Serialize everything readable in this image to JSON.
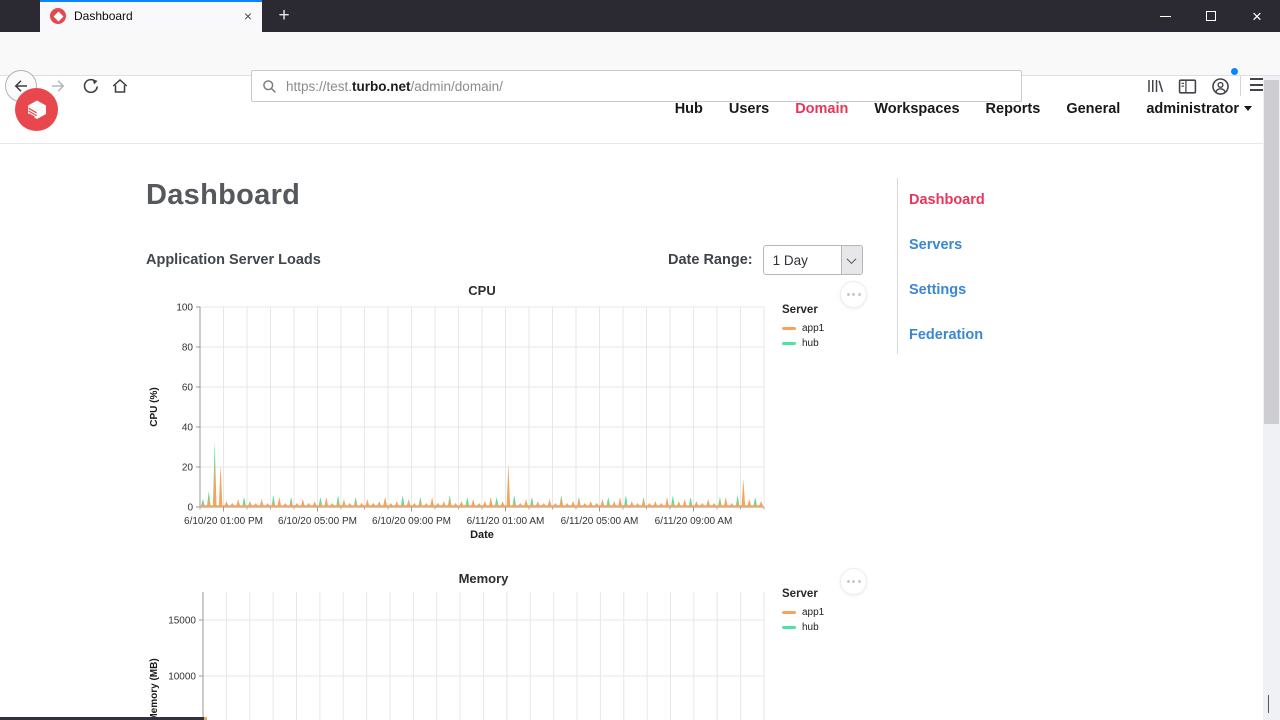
{
  "browser": {
    "tab_title": "Dashboard",
    "new_tab_glyph": "+",
    "tab_close_glyph": "×",
    "window_close_glyph": "×",
    "url_scheme": "https://test.",
    "url_domain": "turbo.net",
    "url_path": "/admin/domain/"
  },
  "header": {
    "nav": [
      {
        "label": "Hub"
      },
      {
        "label": "Users"
      },
      {
        "label": "Domain",
        "active": true
      },
      {
        "label": "Workspaces"
      },
      {
        "label": "Reports"
      },
      {
        "label": "General"
      }
    ],
    "user_label": "administrator"
  },
  "page": {
    "title": "Dashboard",
    "section_title": "Application Server Loads",
    "date_range_label": "Date Range:",
    "date_range_value": "1 Day"
  },
  "sidebar": {
    "items": [
      {
        "label": "Dashboard",
        "active": true
      },
      {
        "label": "Servers",
        "active": false
      },
      {
        "label": "Settings",
        "active": false
      },
      {
        "label": "Federation",
        "active": false
      }
    ]
  },
  "colors": {
    "accent_red": "#e8355a",
    "link_blue": "#3a87d6",
    "logo_red": "#e8474e",
    "series_app1": "#f7a35c",
    "series_hub": "#4be3a2",
    "grid": "#e7e7e7",
    "axis": "#9a9a9a"
  },
  "chart_data": [
    {
      "type": "area",
      "title": "CPU",
      "ylabel": "CPU (%)",
      "xlabel": "Date",
      "ylim": [
        0,
        100
      ],
      "grid": true,
      "legend_position": "right",
      "legend_title": "Server",
      "y_ticks": [
        0,
        20,
        40,
        60,
        80,
        100
      ],
      "x_ticks": [
        "6/10/20 01:00 PM",
        "6/10/20 05:00 PM",
        "6/10/20 09:00 PM",
        "6/11/20 01:00 AM",
        "6/11/20 05:00 AM",
        "6/11/20 09:00 AM"
      ],
      "series": [
        {
          "name": "app1",
          "color": "#f7a35c",
          "values": [
            2,
            5,
            25,
            21,
            3,
            2,
            4,
            2,
            3,
            2,
            4,
            2,
            3,
            5,
            2,
            3,
            2,
            4,
            2,
            3,
            2,
            5,
            2,
            3,
            4,
            2,
            3,
            2,
            4,
            2,
            3,
            5,
            2,
            3,
            2,
            4,
            2,
            3,
            2,
            5,
            2,
            3,
            4,
            2,
            3,
            2,
            4,
            2,
            3,
            5,
            2,
            3,
            22,
            3,
            2,
            4,
            2,
            3,
            2,
            4,
            2,
            5,
            2,
            3,
            4,
            2,
            3,
            2,
            4,
            2,
            3,
            5,
            2,
            3,
            2,
            4,
            2,
            3,
            2,
            5,
            2,
            3,
            4,
            2,
            3,
            2,
            4,
            2,
            3,
            5,
            2,
            3,
            14,
            4,
            2,
            3
          ]
        },
        {
          "name": "hub",
          "color": "#4be3a2",
          "values": [
            4,
            8,
            33,
            5,
            2,
            1,
            1,
            5,
            1,
            1,
            2,
            1,
            6,
            1,
            1,
            5,
            1,
            1,
            2,
            1,
            5,
            1,
            1,
            6,
            1,
            1,
            5,
            1,
            1,
            2,
            1,
            5,
            1,
            1,
            6,
            1,
            1,
            5,
            1,
            1,
            2,
            1,
            6,
            1,
            1,
            5,
            1,
            1,
            2,
            1,
            5,
            1,
            1,
            6,
            1,
            1,
            5,
            1,
            1,
            2,
            1,
            6,
            1,
            1,
            5,
            1,
            1,
            2,
            1,
            5,
            1,
            1,
            6,
            1,
            1,
            5,
            1,
            1,
            2,
            1,
            6,
            1,
            1,
            5,
            1,
            1,
            2,
            1,
            5,
            1,
            1,
            6,
            1,
            1,
            5,
            1
          ]
        }
      ]
    },
    {
      "type": "area",
      "title": "Memory",
      "ylabel": "Memory (MB)",
      "ylim": [
        0,
        17500
      ],
      "grid": true,
      "legend_position": "right",
      "legend_title": "Server",
      "y_ticks": [
        10000,
        15000
      ],
      "x_ticks": [],
      "series": [
        {
          "name": "app1",
          "color": "#f7a35c",
          "values": []
        },
        {
          "name": "hub",
          "color": "#4be3a2",
          "values": []
        }
      ]
    }
  ]
}
